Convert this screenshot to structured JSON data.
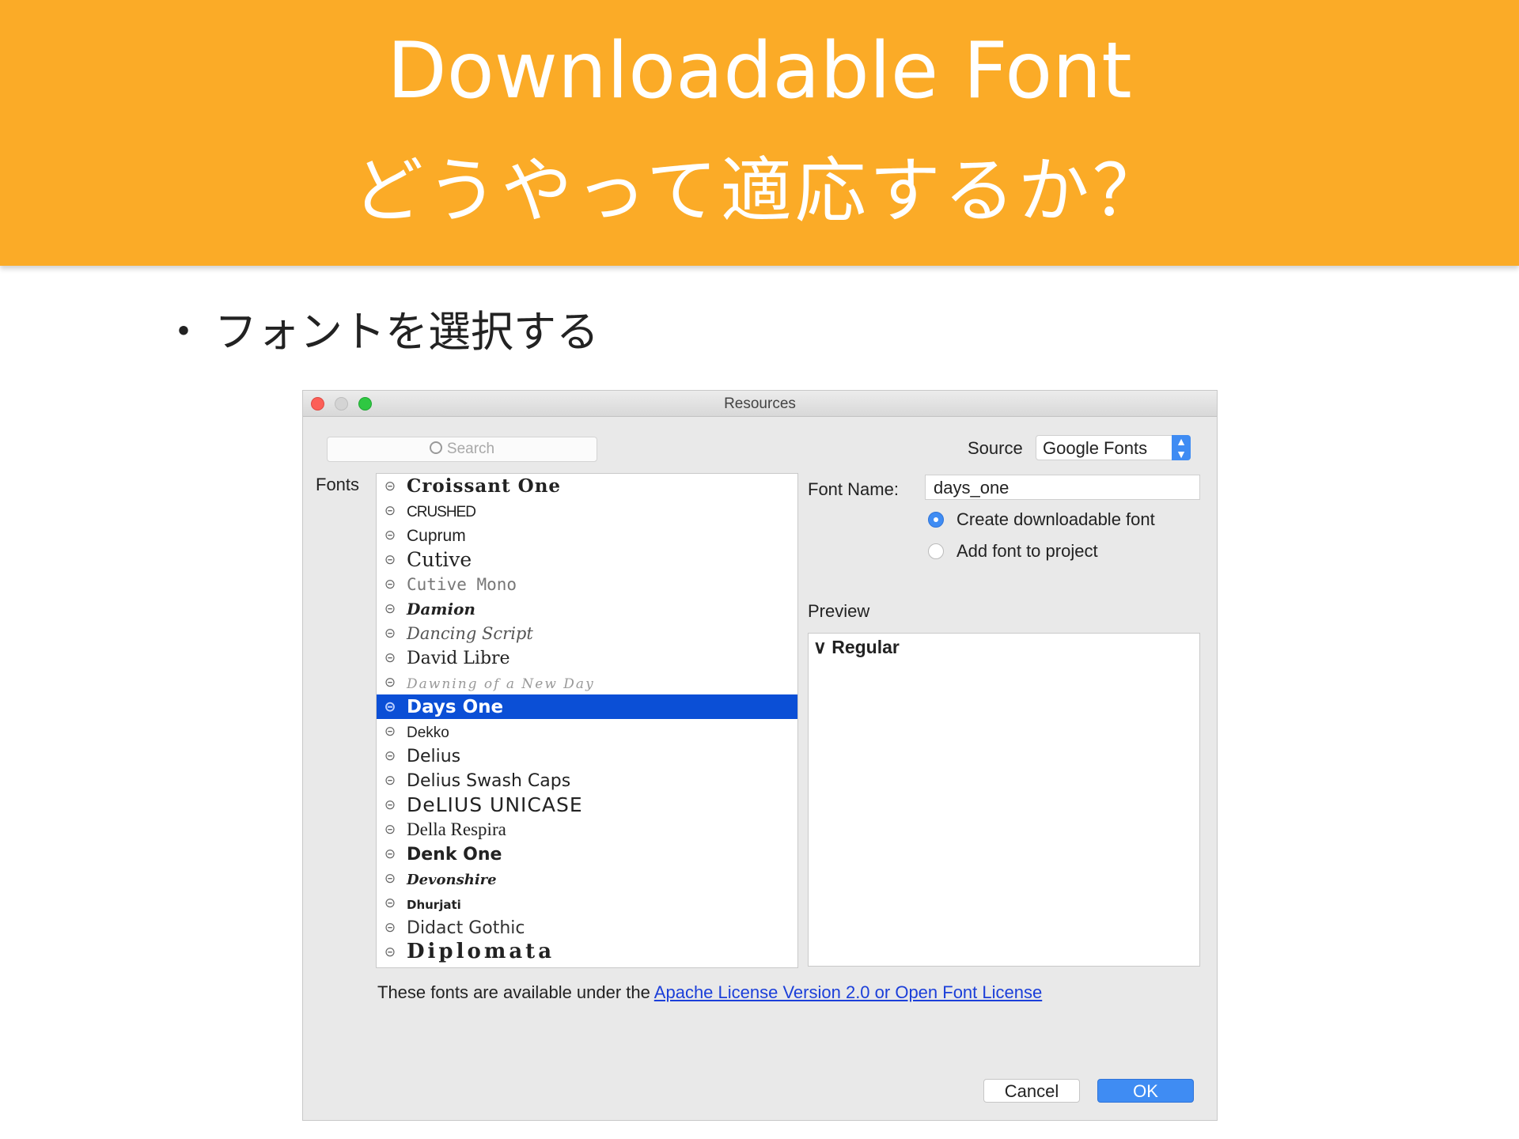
{
  "slide": {
    "title_line1": "Downloadable Font",
    "title_line2": "どうやって適応するか？",
    "bullet_marker": "・",
    "bullet_text": "フォントを選択する"
  },
  "window": {
    "title": "Resources",
    "search_placeholder": "Search",
    "source_label": "Source",
    "source_value": "Google Fonts",
    "fonts_label": "Fonts",
    "font_list": [
      {
        "name": "Croissant One",
        "style": "font-family:'DejaVu Serif',serif;font-weight:bold;letter-spacing:1px;"
      },
      {
        "name": "crushed",
        "style": "font-family:'Liberation Sans',sans-serif;text-transform:uppercase;font-size:19px;letter-spacing:-1px;"
      },
      {
        "name": "Cuprum",
        "style": "font-family:'Liberation Sans',sans-serif;font-size:21px;"
      },
      {
        "name": "Cutive",
        "style": "font-family:'DejaVu Serif',serif;font-size:25px;"
      },
      {
        "name": "Cutive Mono",
        "style": "font-family:'DejaVu Sans Mono',monospace;color:#777;font-size:21px;"
      },
      {
        "name": "Damion",
        "style": "font-family:'DejaVu Serif',serif;font-style:italic;font-weight:bold;font-size:20px;"
      },
      {
        "name": "Dancing Script",
        "style": "font-family:'DejaVu Serif',serif;font-style:italic;color:#555;font-size:21px;"
      },
      {
        "name": "David Libre",
        "style": "font-family:'DejaVu Serif',serif;font-size:22px;"
      },
      {
        "name": "Dawning of a New Day",
        "style": "font-family:'DejaVu Serif',serif;font-style:italic;color:#999;font-size:17px;letter-spacing:2px;"
      },
      {
        "name": "Days One",
        "style": "font-family:'DejaVu Sans',sans-serif;"
      },
      {
        "name": "Dekko",
        "style": "font-family:'Liberation Sans',sans-serif;font-size:19px;"
      },
      {
        "name": "Delius",
        "style": "font-family:'DejaVu Sans',sans-serif;font-size:22px;"
      },
      {
        "name": "Delius Swash Caps",
        "style": "font-family:'DejaVu Sans',sans-serif;font-size:22px;"
      },
      {
        "name": "DeLIUS UNICASE",
        "style": "font-family:'DejaVu Sans',sans-serif;font-size:25px;letter-spacing:1px;"
      },
      {
        "name": "Della Respira",
        "style": "font-family:'Liberation Serif',serif;font-size:23px;"
      },
      {
        "name": "Denk One",
        "style": "font-family:'DejaVu Sans',sans-serif;font-weight:bold;font-size:22px;"
      },
      {
        "name": "Devonshire",
        "style": "font-family:'DejaVu Serif',serif;font-style:italic;font-weight:bold;font-size:18px;"
      },
      {
        "name": "Dhurjati",
        "style": "font-family:'DejaVu Sans',sans-serif;font-weight:bold;font-size:15px;"
      },
      {
        "name": "Didact Gothic",
        "style": "font-family:'DejaVu Sans',sans-serif;font-size:22px;color:#333;"
      },
      {
        "name": "Diplomata",
        "style": "font-family:'DejaVu Serif',serif;font-weight:bold;font-size:26px;letter-spacing:4px;"
      }
    ],
    "selected_font": "Days One",
    "font_name_label": "Font Name:",
    "font_name_value": "days_one",
    "radio_create": "Create downloadable font",
    "radio_add": "Add font to project",
    "preview_label": "Preview",
    "preview_chevron": "∨",
    "preview_item": "Regular",
    "license_text": "These fonts are available under the ",
    "license_link": "Apache License Version 2.0 or Open Font License",
    "cancel_label": "Cancel",
    "ok_label": "OK"
  },
  "colors": {
    "header_bg": "#fbab27",
    "selection": "#0b4fd6",
    "accent": "#3f8cf3"
  },
  "icons": {
    "font_link": "link-icon",
    "search": "search-icon"
  }
}
